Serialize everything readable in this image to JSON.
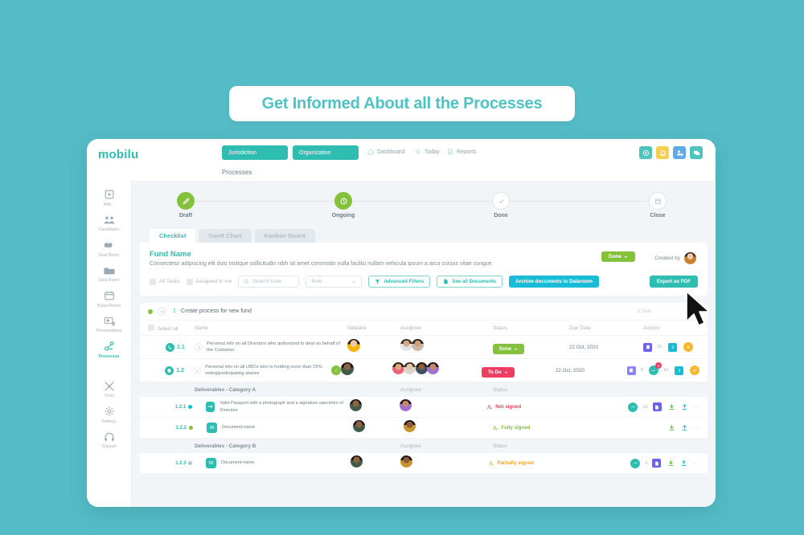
{
  "banner": {
    "text": "Get Informed About all the Processes"
  },
  "colors": {
    "background": "#54bcc6",
    "brand_teal": "#2ebdb0",
    "accent_green": "#84c23d",
    "accent_red": "#ef3e63",
    "accent_yellow": "#f5cf52",
    "accent_blue": "#19bcd6",
    "accent_purple": "#6c63e8",
    "accent_orange": "#f0a529"
  },
  "topbar": {
    "logo": "mobilu",
    "pills": [
      {
        "label": "Jurisdiction",
        "name": "jurisdiction-pill"
      },
      {
        "label": "Organization",
        "name": "organization-pill"
      }
    ],
    "nav": [
      {
        "label": "Dashboard",
        "icon": "home-icon"
      },
      {
        "label": "Today",
        "icon": "sun-icon"
      },
      {
        "label": "Reports",
        "icon": "report-icon"
      }
    ],
    "icons": [
      {
        "name": "add-icon",
        "color": "#4fc3bd"
      },
      {
        "name": "bell-icon",
        "color": "#f5cf52"
      },
      {
        "name": "user-add-icon",
        "color": "#62a9e8"
      },
      {
        "name": "chat-icon",
        "color": "#4fc3bd"
      }
    ],
    "breadcrumb": "Processes"
  },
  "sidebar": {
    "items": [
      {
        "label": "Add...",
        "icon": "plus-square-icon",
        "active": false
      },
      {
        "label": "Candidates",
        "icon": "people-icon",
        "active": false
      },
      {
        "label": "Deal Room",
        "icon": "handshake-icon",
        "active": false
      },
      {
        "label": "Data Room",
        "icon": "folder-icon",
        "active": false
      },
      {
        "label": "Board Room",
        "icon": "calendar-icon",
        "active": false
      },
      {
        "label": "Presentations",
        "icon": "presentation-icon",
        "active": false
      },
      {
        "label": "Processes",
        "icon": "workflow-icon",
        "active": true
      },
      {
        "label": "Tools",
        "icon": "tools-icon",
        "active": false
      },
      {
        "label": "Settings",
        "icon": "gear-icon",
        "active": false
      },
      {
        "label": "Support",
        "icon": "headset-icon",
        "active": false
      }
    ]
  },
  "stepper": {
    "steps": [
      {
        "label": "Draft",
        "icon": "pencil-icon",
        "state": "done"
      },
      {
        "label": "Ongoing",
        "icon": "clock-icon",
        "state": "done"
      },
      {
        "label": "Done",
        "icon": "check-icon",
        "state": "pending"
      },
      {
        "label": "Close",
        "icon": "archive-icon",
        "state": "pending"
      }
    ]
  },
  "tabs": [
    {
      "label": "Checklist",
      "active": true
    },
    {
      "label": "Gantt Chart",
      "active": false
    },
    {
      "label": "Kanban Board",
      "active": false
    }
  ],
  "fund": {
    "title": "Fund Name",
    "description": "Consectetur adipiscing elit duis tristique sollicitudin nibh sit amet commodo nulla facilisi nullam vehicula ipsum a arcu cursus vitae congue",
    "status_label": "Done",
    "created_by_label": "Created by"
  },
  "toolbar": {
    "all_tasks": "All Tasks",
    "assigned_to_me": "Assigned to me",
    "search_placeholder": "Search User",
    "role_placeholder": "Role",
    "advanced_filters": "Advanced Filters",
    "see_all_documents": "See all Documents",
    "archive_documents": "Archive documents to Dataroom",
    "export_as_pdf": "Export as PDF"
  },
  "group": {
    "number": "1",
    "title": "Create process for new fund",
    "task_count": "3 Task"
  },
  "table": {
    "headers": {
      "select_all": "Select all",
      "name": "Name",
      "validator": "Validator",
      "assignee": "Assignee",
      "status": "Status",
      "due_date": "Due Date",
      "actions": "Actions"
    },
    "rows": [
      {
        "id": "1.1",
        "icon": "phone-circle-icon",
        "icon_color": "#2ebdb0",
        "name": "Personal info on all Directors who authorized to deal on behalf of the Customer",
        "validators": [
          {
            "name": "avatar",
            "color": "#f2b705"
          }
        ],
        "assignees": [
          {
            "name": "avatar",
            "color": "#cdd6db"
          },
          {
            "name": "avatar",
            "color": "#c9b8ad"
          }
        ],
        "status": "Done",
        "status_type": "done",
        "due_date": "22 Oct, 2020",
        "actions": [
          {
            "name": "document-icon",
            "color": "#6c63e8",
            "count": "10"
          },
          {
            "name": "info-icon",
            "color": "#19bcd6",
            "count": ""
          },
          {
            "name": "add-icon",
            "color": "#f5b82e",
            "count": ""
          }
        ]
      },
      {
        "id": "1.2",
        "icon": "shield-circle-icon",
        "icon_color": "#2ebdb0",
        "name": "Personal info on all UBOs who is holding more than 25% voting/participating shares",
        "badge_icon": "alert-badge-icon",
        "validators": [
          {
            "name": "avatar",
            "color": "#4a6b55"
          }
        ],
        "assignees": [
          {
            "name": "avatar",
            "color": "#e8637a"
          },
          {
            "name": "avatar",
            "color": "#dcd3cb"
          },
          {
            "name": "avatar",
            "color": "#3d4f63"
          },
          {
            "name": "avatar",
            "color": "#a36fd1"
          }
        ],
        "status": "To Do",
        "status_type": "todo",
        "due_date": "22 Oct, 2020",
        "actions": [
          {
            "name": "document-icon",
            "color": "#6c63e8",
            "count": "8"
          },
          {
            "name": "chat-icon",
            "color": "#2ebdb0",
            "count": "10",
            "badge": "3"
          },
          {
            "name": "info-icon",
            "color": "#19bcd6",
            "count": ""
          },
          {
            "name": "add-icon",
            "color": "#f5b82e",
            "count": ""
          }
        ]
      }
    ],
    "sections": [
      {
        "title": "Deliverables - Category A",
        "assignee_label": "Assignee",
        "status_label": "Status",
        "rows": [
          {
            "id": "1.2.1",
            "dot_color": "#19bcd6",
            "type_icon": "passport-icon",
            "name": "Valid Passport with a photograph and a signature specimen of Directors",
            "validator": {
              "name": "avatar",
              "color": "#4a6b55"
            },
            "assignee": {
              "name": "avatar",
              "color": "#a36fd1"
            },
            "sign_status": "Not signed",
            "sign_type": "not",
            "actions": [
              {
                "name": "chat-icon",
                "color": "#2ebdb0",
                "count": "10"
              },
              {
                "name": "document-icon",
                "color": "#6c63e8",
                "count": ""
              },
              {
                "name": "download-icon",
                "color": "#5bbf2e",
                "count": ""
              },
              {
                "name": "upload-icon",
                "color": "#19bcd6",
                "count": ""
              },
              {
                "name": "more-icon",
                "color": "#c2ccd2",
                "count": ""
              }
            ]
          },
          {
            "id": "1.2.2",
            "dot_color": "#84c23d",
            "type_icon": "document-list-icon",
            "name": "Document-name",
            "validator": {
              "name": "avatar",
              "color": "#4a6b55"
            },
            "assignee": {
              "name": "avatar",
              "color": "#3d4f63"
            },
            "sign_status": "Fully signed",
            "sign_type": "full",
            "actions": [
              {
                "name": "download-icon",
                "color": "#5bbf2e",
                "count": ""
              },
              {
                "name": "upload-icon",
                "color": "#19bcd6",
                "count": ""
              },
              {
                "name": "more-icon",
                "color": "#c2ccd2",
                "count": ""
              }
            ]
          }
        ]
      },
      {
        "title": "Deliverables - Category B",
        "assignee_label": "Assignee",
        "status_label": "Status",
        "rows": [
          {
            "id": "1.2.3",
            "dot_color": "#b8c2c9",
            "type_icon": "document-list-icon",
            "name": "Document-name",
            "validator": {
              "name": "avatar",
              "color": "#4a6b55"
            },
            "assignee": {
              "name": "avatar",
              "color": "#3d4f63"
            },
            "sign_status": "Partially signed",
            "sign_type": "part",
            "actions": [
              {
                "name": "chat-icon",
                "color": "#2ebdb0",
                "count": "3"
              },
              {
                "name": "document-icon",
                "color": "#6c63e8",
                "count": ""
              },
              {
                "name": "download-icon",
                "color": "#5bbf2e",
                "count": ""
              },
              {
                "name": "upload-icon",
                "color": "#19bcd6",
                "count": ""
              },
              {
                "name": "more-icon",
                "color": "#c2ccd2",
                "count": ""
              }
            ]
          }
        ]
      }
    ]
  }
}
